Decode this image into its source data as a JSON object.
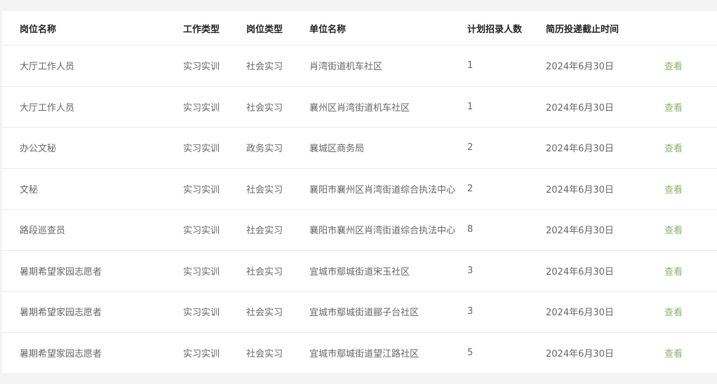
{
  "table": {
    "headers": [
      "岗位名称",
      "工作类型",
      "岗位类型",
      "单位名称",
      "计划招录人数",
      "简历投递截止时间",
      ""
    ],
    "rows": [
      {
        "position": "大厅工作人员",
        "work_type": "实习实训",
        "post_type": "社会实习",
        "unit": "肖湾街道机车社区",
        "count": "1",
        "deadline": "2024年6月30日",
        "action": "查看"
      },
      {
        "position": "大厅工作人员",
        "work_type": "实习实训",
        "post_type": "社会实习",
        "unit": "襄州区肖湾街道机车社区",
        "count": "1",
        "deadline": "2024年6月30日",
        "action": "查看"
      },
      {
        "position": "办公文秘",
        "work_type": "实习实训",
        "post_type": "政务实习",
        "unit": "襄城区商务局",
        "count": "2",
        "deadline": "2024年6月30日",
        "action": "查看"
      },
      {
        "position": "文秘",
        "work_type": "实习实训",
        "post_type": "社会实习",
        "unit": "襄阳市襄州区肖湾街道综合执法中心",
        "count": "2",
        "deadline": "2024年6月30日",
        "action": "查看"
      },
      {
        "position": "路段巡查员",
        "work_type": "实习实训",
        "post_type": "社会实习",
        "unit": "襄阳市襄州区肖湾街道综合执法中心",
        "count": "8",
        "deadline": "2024年6月30日",
        "action": "查看"
      },
      {
        "position": "暑期希望家园志愿者",
        "work_type": "实习实训",
        "post_type": "社会实习",
        "unit": "宜城市鄢城街道宋玉社区",
        "count": "3",
        "deadline": "2024年6月30日",
        "action": "查看"
      },
      {
        "position": "暑期希望家园志愿者",
        "work_type": "实习实训",
        "post_type": "社会实习",
        "unit": "宜城市鄢城街道郦子台社区",
        "count": "3",
        "deadline": "2024年6月30日",
        "action": "查看"
      },
      {
        "position": "暑期希望家园志愿者",
        "work_type": "实习实训",
        "post_type": "社会实习",
        "unit": "宜城市鄢城街道望江路社区",
        "count": "5",
        "deadline": "2024年6月30日",
        "action": "查看"
      }
    ]
  },
  "colors": {
    "link": "#8ab36a",
    "header_text": "#222222",
    "cell_text": "#666666"
  }
}
